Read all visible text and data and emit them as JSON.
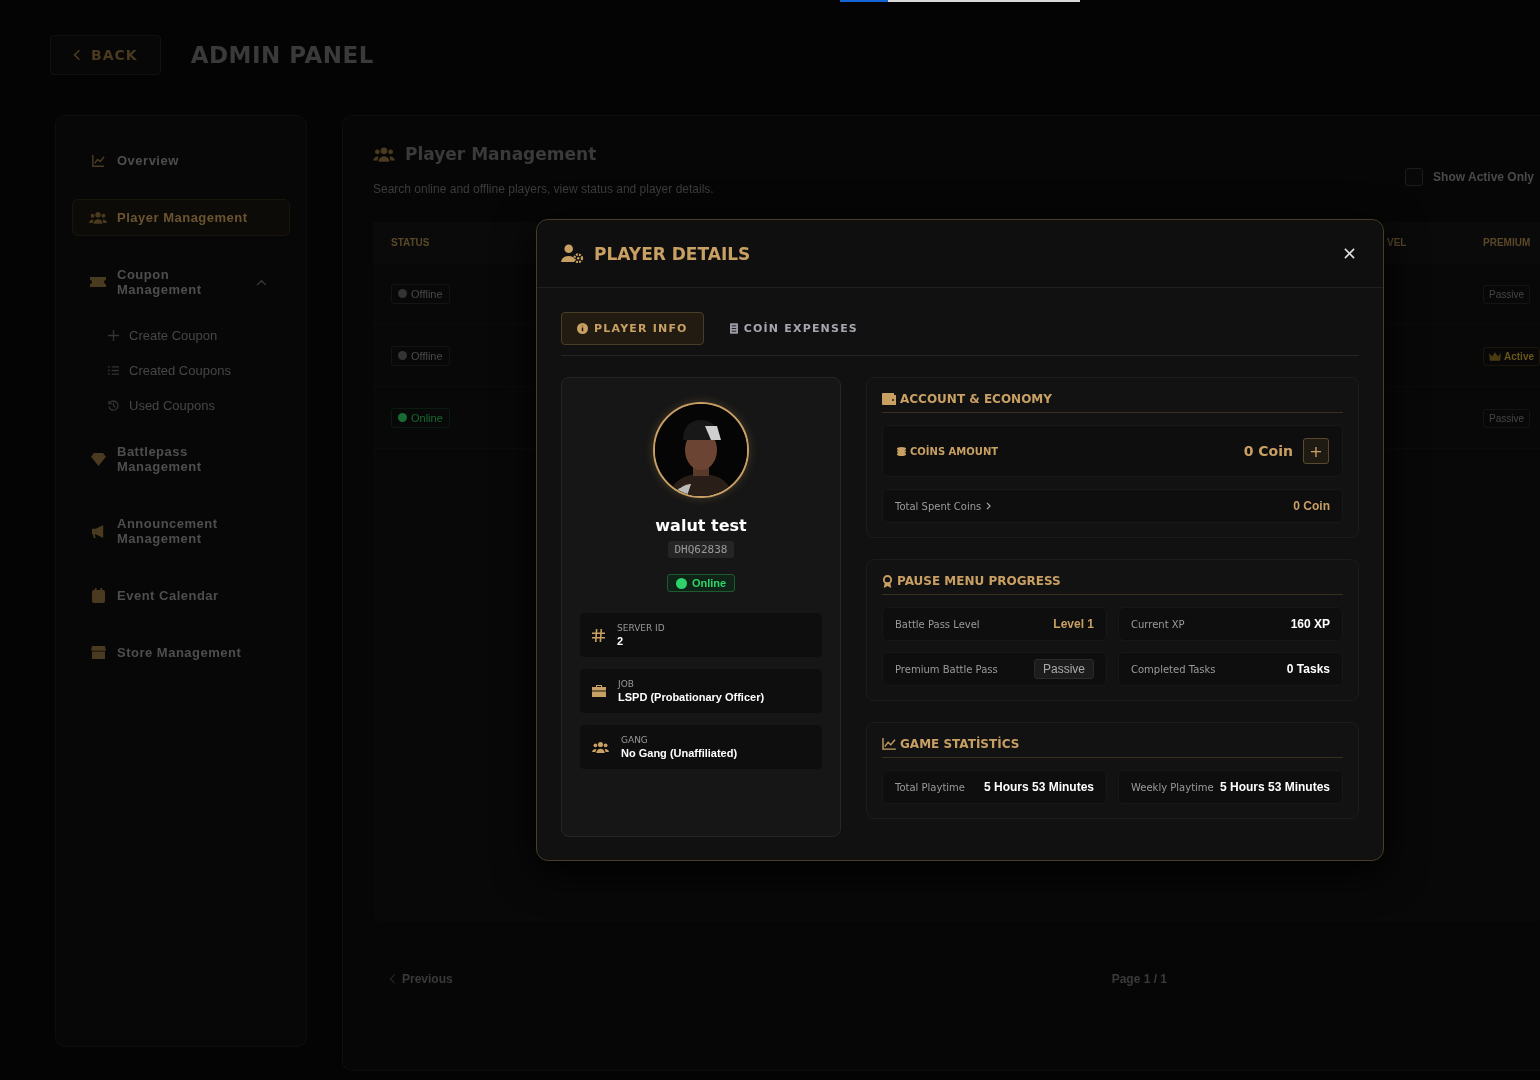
{
  "top_progress": {
    "level": 0.2
  },
  "header": {
    "back_label": "BACK",
    "title": "ADMIN PANEL"
  },
  "sidebar": {
    "items": [
      {
        "label": "Overview",
        "selected": false
      },
      {
        "label": "Player Management",
        "selected": true
      },
      {
        "label": "Coupon Management",
        "selected": false,
        "expanded": true,
        "children": [
          {
            "label": "Create Coupon",
            "selected": false
          },
          {
            "label": "Created Coupons",
            "selected": false
          },
          {
            "label": "Used Coupons",
            "selected": false
          }
        ]
      },
      {
        "label": "Battlepass Management",
        "selected": false
      },
      {
        "label": "Announcement Management",
        "selected": false
      },
      {
        "label": "Event Calendar",
        "selected": false
      },
      {
        "label": "Store Management",
        "selected": false
      }
    ]
  },
  "main": {
    "title": "Player Management",
    "subtitle": "Search online and offline players, view status and player details.",
    "show_active_only": {
      "label": "Show Active Only",
      "checked": false
    },
    "table": {
      "columns": [
        "STATUS",
        "VEL",
        "PREMIUM"
      ],
      "rows": [
        {
          "status": "Offline",
          "online": false,
          "premium": "Passive",
          "premium_active": false
        },
        {
          "status": "Offline",
          "online": false,
          "premium": "Active",
          "premium_active": true
        },
        {
          "status": "Online",
          "online": true,
          "premium": "Passive",
          "premium_active": false
        }
      ]
    },
    "pagination": {
      "previous": "Previous",
      "page": "Page 1 / 1"
    }
  },
  "modal": {
    "title": "PLAYER DETAILS",
    "tabs": [
      {
        "label": "PLAYER INFO",
        "selected": true
      },
      {
        "label": "COİN EXPENSES",
        "selected": false
      }
    ],
    "player": {
      "name": "walut test",
      "citizen_id": "DHQ62838",
      "status": "Online",
      "online": true,
      "fields": [
        {
          "label": "SERVER ID",
          "value": "2"
        },
        {
          "label": "JOB",
          "value": "LSPD (Probationary Officer)"
        },
        {
          "label": "GANG",
          "value": "No Gang (Unaffiliated)"
        }
      ]
    },
    "account": {
      "title": "ACCOUNT & ECONOMY",
      "coins_label": "COİNS AMOUNT",
      "coins_value": "0 Coin",
      "add": "+",
      "spent_label": "Total Spent Coins",
      "spent_value": "0 Coin"
    },
    "progress": {
      "title": "PAUSE MENU PROGRESS",
      "stats": [
        {
          "label": "Battle Pass Level",
          "value": "Level 1",
          "kind": "gold"
        },
        {
          "label": "Current XP",
          "value": "160 XP",
          "kind": "plain"
        },
        {
          "label": "Premium Battle Pass",
          "value": "Passive",
          "kind": "badge"
        },
        {
          "label": "Completed Tasks",
          "value": "0 Tasks",
          "kind": "plain"
        }
      ]
    },
    "statistics": {
      "title": "GAME STATİSTİCS",
      "stats": [
        {
          "label": "Total Playtime",
          "value": "5 Hours 53 Minutes"
        },
        {
          "label": "Weekly Playtime",
          "value": "5 Hours 53 Minutes"
        }
      ]
    }
  }
}
